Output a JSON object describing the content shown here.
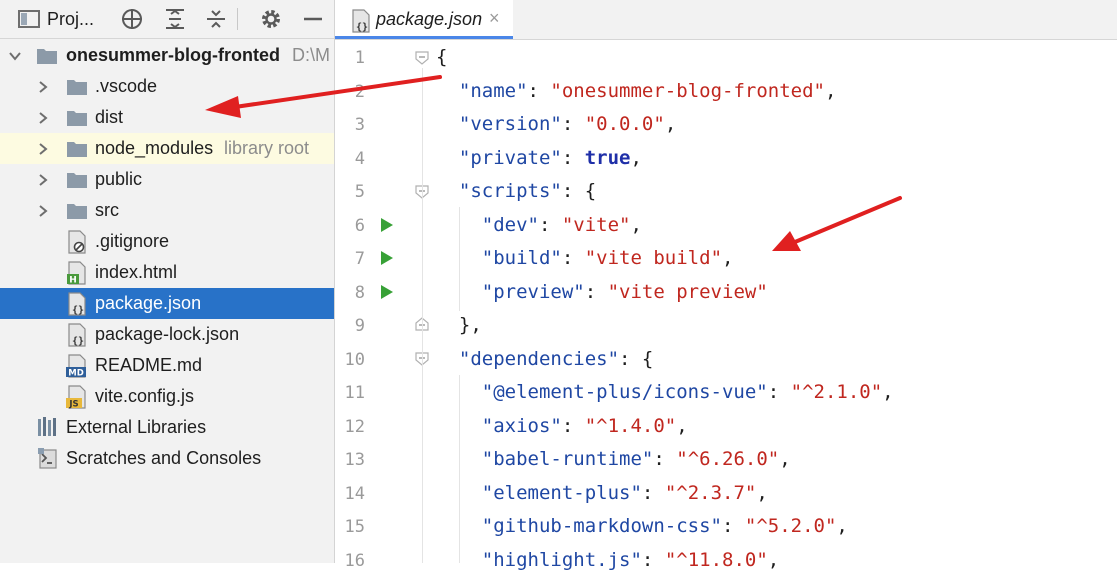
{
  "project_panel": {
    "title": "Proj...",
    "tree": [
      {
        "label": "onesummer-blog-fronted",
        "hint": "D:\\M",
        "type": "root-folder",
        "expanded": true
      },
      {
        "label": ".vscode",
        "type": "folder"
      },
      {
        "label": "dist",
        "type": "folder"
      },
      {
        "label": "node_modules",
        "hint": "library root",
        "type": "folder"
      },
      {
        "label": "public",
        "type": "folder"
      },
      {
        "label": "src",
        "type": "folder"
      },
      {
        "label": ".gitignore",
        "type": "file",
        "icon": "gitignore-file-icon"
      },
      {
        "label": "index.html",
        "type": "file",
        "icon": "html-file-icon",
        "icon_text": "H"
      },
      {
        "label": "package.json",
        "type": "file",
        "icon": "json-file-icon",
        "selected": true
      },
      {
        "label": "package-lock.json",
        "type": "file",
        "icon": "json-file-icon"
      },
      {
        "label": "README.md",
        "type": "file",
        "icon": "markdown-file-icon",
        "icon_text": "MD"
      },
      {
        "label": "vite.config.js",
        "type": "file",
        "icon": "javascript-file-icon",
        "icon_text": "JS"
      },
      {
        "label": "External Libraries",
        "type": "libraries"
      },
      {
        "label": "Scratches and Consoles",
        "type": "scratches"
      }
    ]
  },
  "editor": {
    "tab": {
      "label": "package.json",
      "close": "×",
      "icon_text": "{}"
    },
    "line_numbers": [
      "1",
      "2",
      "3",
      "4",
      "5",
      "6",
      "7",
      "8",
      "9",
      "10",
      "11",
      "12",
      "13",
      "14",
      "15",
      "16"
    ],
    "lines": [
      [
        {
          "t": "{",
          "c": "p"
        }
      ],
      [
        {
          "t": "  ",
          "c": "p"
        },
        {
          "t": "\"name\"",
          "c": "k"
        },
        {
          "t": ": ",
          "c": "p"
        },
        {
          "t": "\"onesummer-blog-fronted\"",
          "c": "s"
        },
        {
          "t": ",",
          "c": "p"
        }
      ],
      [
        {
          "t": "  ",
          "c": "p"
        },
        {
          "t": "\"version\"",
          "c": "k"
        },
        {
          "t": ": ",
          "c": "p"
        },
        {
          "t": "\"0.0.0\"",
          "c": "s"
        },
        {
          "t": ",",
          "c": "p"
        }
      ],
      [
        {
          "t": "  ",
          "c": "p"
        },
        {
          "t": "\"private\"",
          "c": "k"
        },
        {
          "t": ": ",
          "c": "p"
        },
        {
          "t": "true",
          "c": "b"
        },
        {
          "t": ",",
          "c": "p"
        }
      ],
      [
        {
          "t": "  ",
          "c": "p"
        },
        {
          "t": "\"scripts\"",
          "c": "k"
        },
        {
          "t": ": {",
          "c": "p"
        }
      ],
      [
        {
          "t": "    ",
          "c": "p"
        },
        {
          "t": "\"dev\"",
          "c": "k"
        },
        {
          "t": ": ",
          "c": "p"
        },
        {
          "t": "\"vite\"",
          "c": "s"
        },
        {
          "t": ",",
          "c": "p"
        }
      ],
      [
        {
          "t": "    ",
          "c": "p"
        },
        {
          "t": "\"build\"",
          "c": "k"
        },
        {
          "t": ": ",
          "c": "p"
        },
        {
          "t": "\"vite build\"",
          "c": "s"
        },
        {
          "t": ",",
          "c": "p"
        }
      ],
      [
        {
          "t": "    ",
          "c": "p"
        },
        {
          "t": "\"preview\"",
          "c": "k"
        },
        {
          "t": ": ",
          "c": "p"
        },
        {
          "t": "\"vite preview\"",
          "c": "s"
        }
      ],
      [
        {
          "t": "  },",
          "c": "p"
        }
      ],
      [
        {
          "t": "  ",
          "c": "p"
        },
        {
          "t": "\"dependencies\"",
          "c": "k"
        },
        {
          "t": ": {",
          "c": "p"
        }
      ],
      [
        {
          "t": "    ",
          "c": "p"
        },
        {
          "t": "\"@element-plus/icons-vue\"",
          "c": "k"
        },
        {
          "t": ": ",
          "c": "p"
        },
        {
          "t": "\"^2.1.0\"",
          "c": "s"
        },
        {
          "t": ",",
          "c": "p"
        }
      ],
      [
        {
          "t": "    ",
          "c": "p"
        },
        {
          "t": "\"axios\"",
          "c": "k"
        },
        {
          "t": ": ",
          "c": "p"
        },
        {
          "t": "\"^1.4.0\"",
          "c": "s"
        },
        {
          "t": ",",
          "c": "p"
        }
      ],
      [
        {
          "t": "    ",
          "c": "p"
        },
        {
          "t": "\"babel-runtime\"",
          "c": "k"
        },
        {
          "t": ": ",
          "c": "p"
        },
        {
          "t": "\"^6.26.0\"",
          "c": "s"
        },
        {
          "t": ",",
          "c": "p"
        }
      ],
      [
        {
          "t": "    ",
          "c": "p"
        },
        {
          "t": "\"element-plus\"",
          "c": "k"
        },
        {
          "t": ": ",
          "c": "p"
        },
        {
          "t": "\"^2.3.7\"",
          "c": "s"
        },
        {
          "t": ",",
          "c": "p"
        }
      ],
      [
        {
          "t": "    ",
          "c": "p"
        },
        {
          "t": "\"github-markdown-css\"",
          "c": "k"
        },
        {
          "t": ": ",
          "c": "p"
        },
        {
          "t": "\"^5.2.0\"",
          "c": "s"
        },
        {
          "t": ",",
          "c": "p"
        }
      ],
      [
        {
          "t": "    ",
          "c": "p"
        },
        {
          "t": "\"highlight.js\"",
          "c": "k"
        },
        {
          "t": ": ",
          "c": "p"
        },
        {
          "t": "\"^11.8.0\"",
          "c": "s"
        },
        {
          "t": ",",
          "c": "p"
        }
      ]
    ],
    "run_gutter_lines": [
      6,
      7,
      8
    ],
    "fold_lines": [
      1,
      5,
      9,
      10
    ]
  },
  "colors": {
    "selection": "#2872c8",
    "library_root_bg": "#fdfbe1",
    "json_key": "#1f47a3",
    "json_string": "#c0271f",
    "run_marker": "#38a137",
    "annotation_arrow": "#e02020"
  }
}
